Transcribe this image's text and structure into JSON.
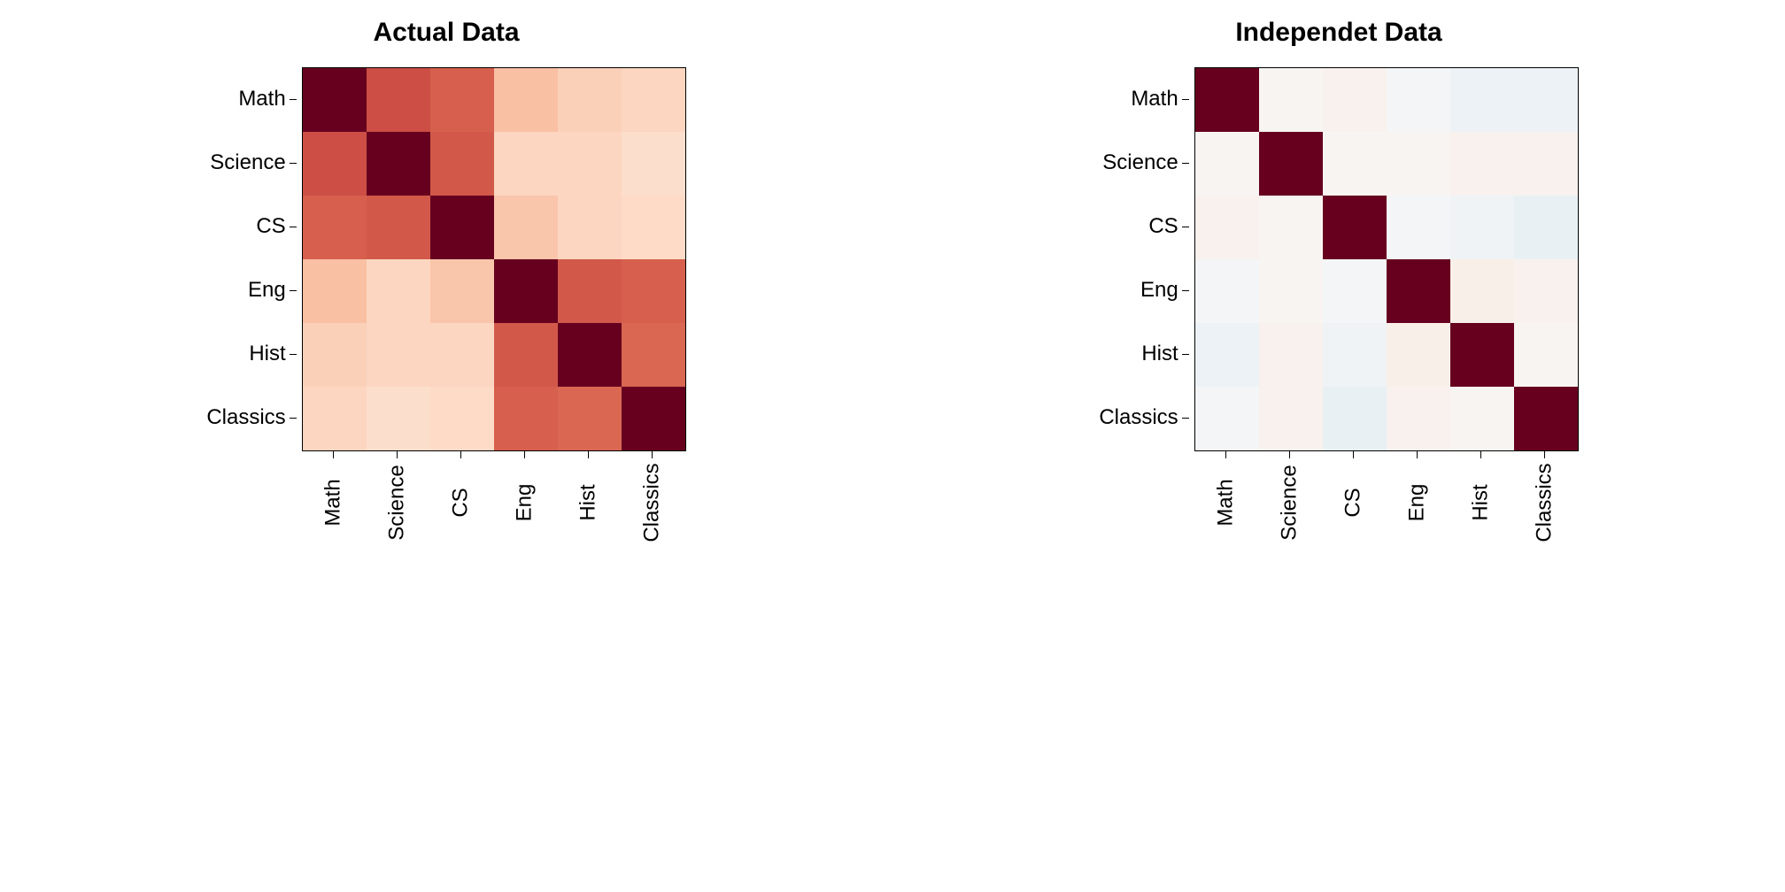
{
  "chart_data": [
    {
      "type": "heatmap",
      "title": "Actual Data",
      "categories": [
        "Math",
        "Science",
        "CS",
        "Eng",
        "Hist",
        "Classics"
      ],
      "row_labels": [
        "Math",
        "Science",
        "CS",
        "Eng",
        "Hist",
        "Classics"
      ],
      "values": [
        [
          1.0,
          0.65,
          0.6,
          0.3,
          0.24,
          0.22
        ],
        [
          0.65,
          1.0,
          0.62,
          0.22,
          0.22,
          0.18
        ],
        [
          0.6,
          0.62,
          1.0,
          0.28,
          0.22,
          0.2
        ],
        [
          0.3,
          0.22,
          0.28,
          1.0,
          0.62,
          0.6
        ],
        [
          0.24,
          0.22,
          0.22,
          0.62,
          1.0,
          0.58
        ],
        [
          0.22,
          0.18,
          0.2,
          0.6,
          0.58,
          1.0
        ]
      ],
      "colormap": "RdBu_r",
      "vmin": -1.0,
      "vmax": 1.0
    },
    {
      "type": "heatmap",
      "title": "Independet Data",
      "categories": [
        "Math",
        "Science",
        "CS",
        "Eng",
        "Hist",
        "Classics"
      ],
      "row_labels": [
        "Math",
        "Science",
        "CS",
        "Eng",
        "Hist",
        "Classics"
      ],
      "values": [
        [
          1.0,
          0.02,
          0.04,
          -0.02,
          -0.06,
          -0.06
        ],
        [
          0.02,
          1.0,
          0.02,
          0.02,
          0.04,
          0.04
        ],
        [
          0.04,
          0.02,
          1.0,
          -0.02,
          -0.04,
          -0.08
        ],
        [
          -0.02,
          0.02,
          -0.02,
          1.0,
          0.06,
          0.04
        ],
        [
          -0.06,
          0.04,
          -0.04,
          0.06,
          1.0,
          0.02
        ],
        [
          -0.02,
          0.04,
          -0.08,
          0.04,
          0.02,
          1.0
        ]
      ],
      "colormap": "RdBu_r",
      "vmin": -1.0,
      "vmax": 1.0
    }
  ]
}
